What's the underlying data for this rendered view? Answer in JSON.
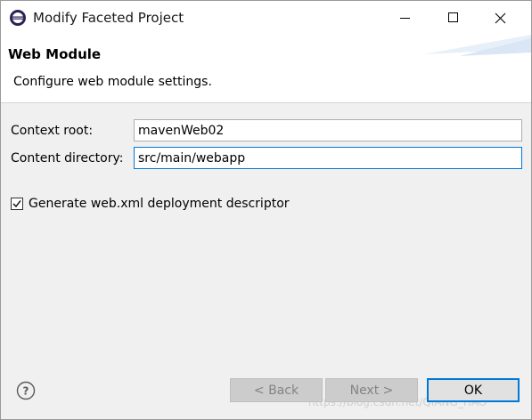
{
  "window": {
    "title": "Modify Faceted Project"
  },
  "banner": {
    "title": "Web Module",
    "description": "Configure web module settings."
  },
  "form": {
    "context_root_label": "Context root:",
    "context_root_value": "mavenWeb02",
    "content_directory_label": "Content directory:",
    "content_directory_value": "src/main/webapp",
    "generate_xml_label": "Generate web.xml deployment descriptor",
    "generate_xml_checked": true
  },
  "buttons": {
    "back": "< Back",
    "next": "Next >",
    "ok": "OK"
  },
  "watermark": "https://blog.csdn.net/QIANG_HAO",
  "colors": {
    "accent": "#0078d7",
    "panel": "#f0f0f0",
    "disabled_button": "#cccccc"
  },
  "icons": [
    "eclipse-icon",
    "minimize-icon",
    "maximize-icon",
    "close-icon",
    "checkmark-icon",
    "help-icon"
  ]
}
